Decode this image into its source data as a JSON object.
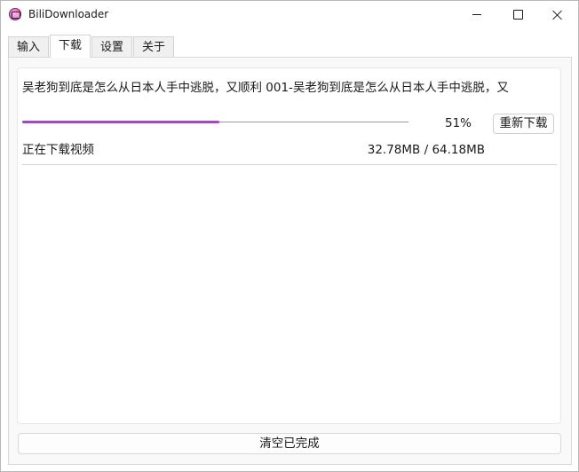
{
  "window": {
    "title": "BiliDownloader",
    "icon": "bilibili-downloader-app-icon"
  },
  "tabs": [
    {
      "label": "输入",
      "active": false
    },
    {
      "label": "下载",
      "active": true
    },
    {
      "label": "设置",
      "active": false
    },
    {
      "label": "关于",
      "active": false
    }
  ],
  "download_item": {
    "title": "吴老狗到底是怎么从日本人手中逃脱，又顺利 001-吴老狗到底是怎么从日本人手中逃脱，又",
    "progress_fraction": 0.51,
    "progress_label": "51%",
    "retry_label": "重新下载",
    "status": "正在下载视频",
    "size_label": "32.78MB / 64.18MB"
  },
  "footer": {
    "clear_label": "清空已完成"
  },
  "colors": {
    "progress_fill": "#9b4fb3",
    "progress_track": "#9a9a9a"
  }
}
